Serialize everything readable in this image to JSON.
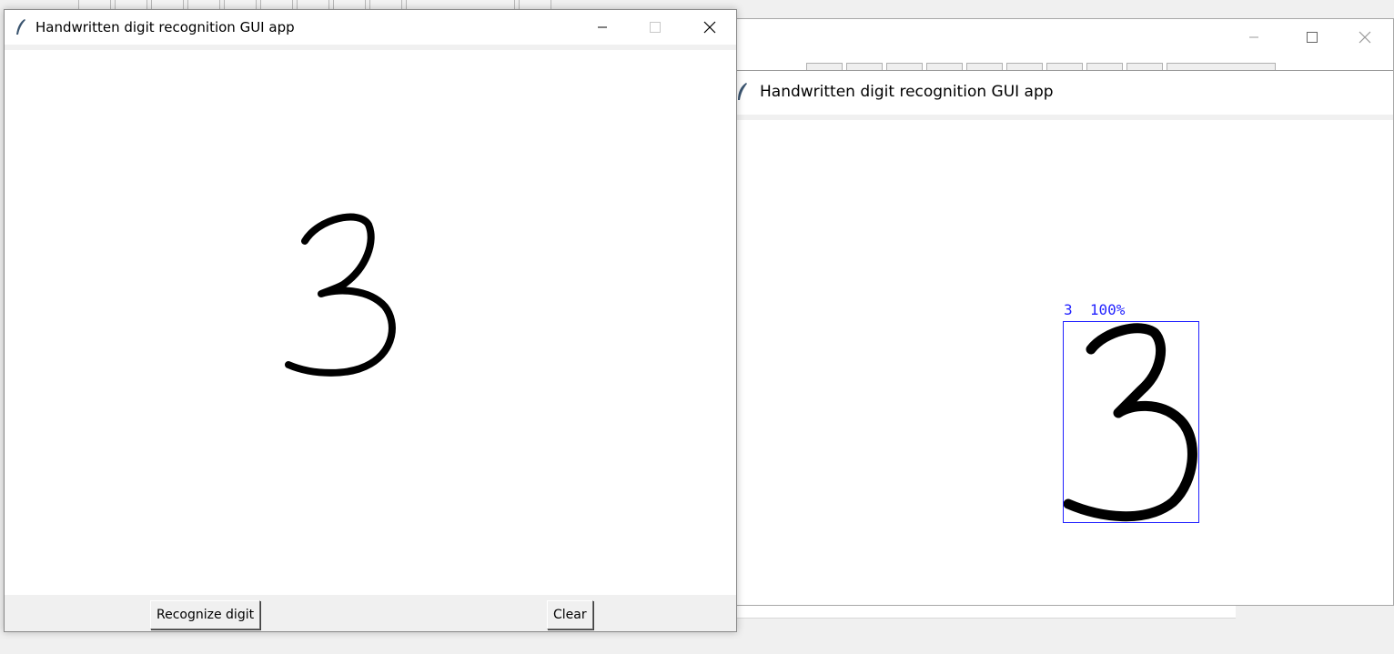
{
  "front_window": {
    "title": "Handwritten digit recognition GUI app",
    "buttons": {
      "recognize_label": "Recognize digit",
      "clear_label": "Clear"
    }
  },
  "back_window": {
    "title": "Handwritten digit recognition GUI app",
    "prediction": {
      "digit": "3",
      "confidence": "100%",
      "label_text": "3  100%"
    }
  },
  "colors": {
    "prediction_box": "#2020ff",
    "ink": "#000000",
    "window_bg": "#ffffff",
    "chrome_bg": "#f0f0f0"
  },
  "icons": [
    "feather-icon",
    "minimize-icon",
    "maximize-icon",
    "close-icon"
  ]
}
